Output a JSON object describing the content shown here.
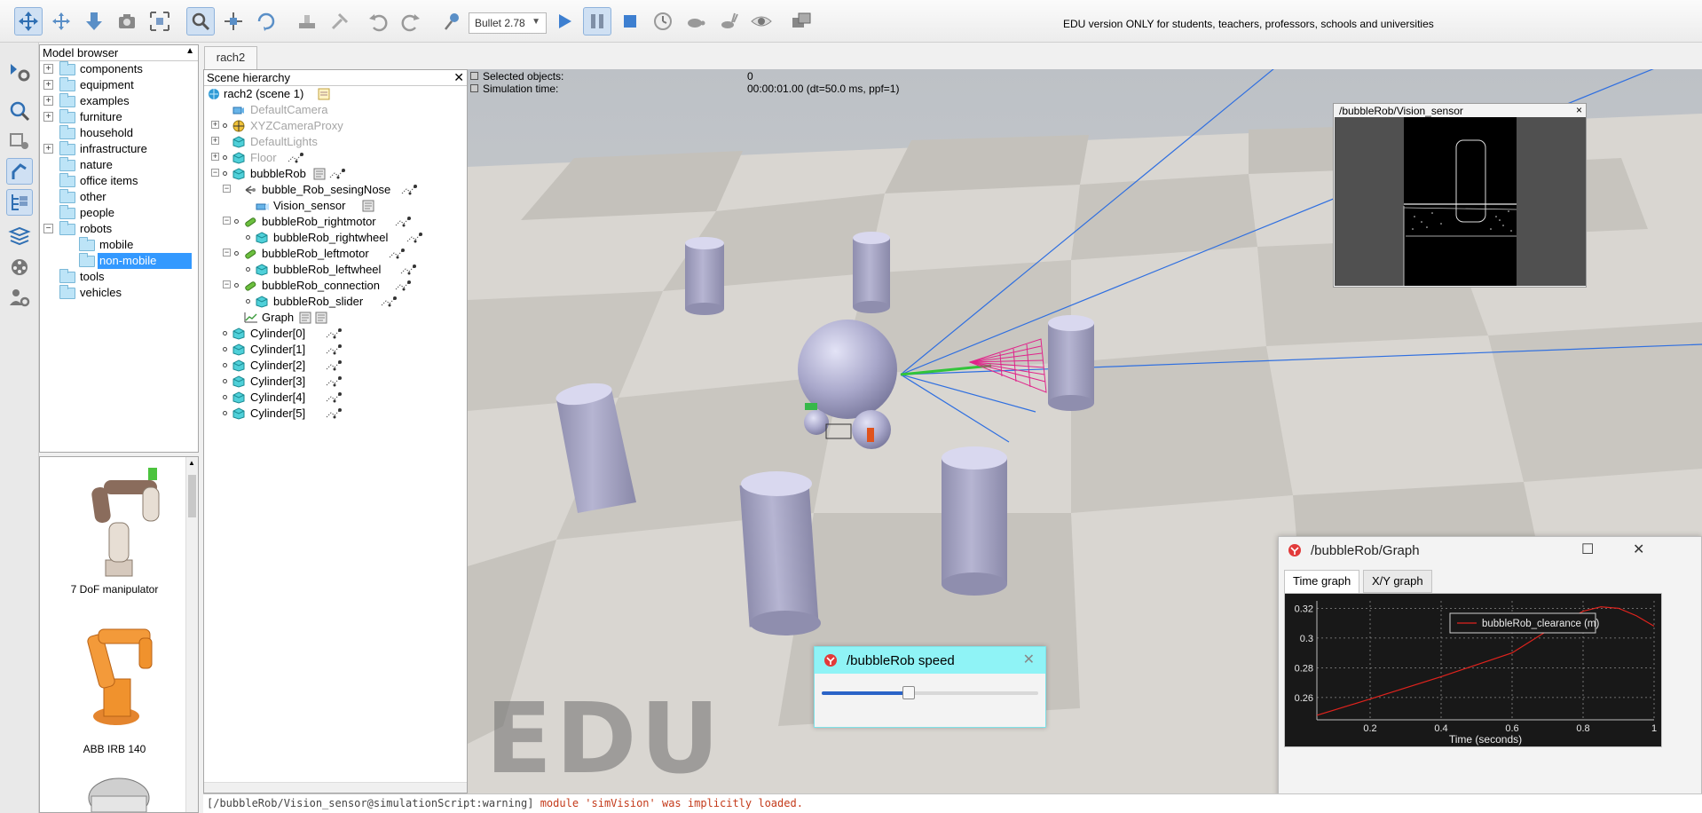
{
  "toolbar": {
    "engine": "Bullet 2.78",
    "edu_banner": "EDU version ONLY for students, teachers, professors, schools and universities",
    "buttons": [
      "camera-pan",
      "camera-rotate",
      "camera-shift",
      "camera-angle",
      "fit-to-view",
      "click-select",
      "object-shift",
      "object-rotate",
      "assemble",
      "transfer-dna",
      "undo",
      "redo",
      "dynamics-properties",
      "start-simulation",
      "pause-simulation",
      "stop-simulation",
      "real-time",
      "slow-down",
      "speed-up",
      "visualization-toggle",
      "page-selector"
    ]
  },
  "model_browser": {
    "title": "Model browser",
    "items": [
      {
        "label": "components",
        "expandable": true
      },
      {
        "label": "equipment",
        "expandable": true
      },
      {
        "label": "examples",
        "expandable": true
      },
      {
        "label": "furniture",
        "expandable": true
      },
      {
        "label": "household",
        "expandable": false
      },
      {
        "label": "infrastructure",
        "expandable": true
      },
      {
        "label": "nature",
        "expandable": false
      },
      {
        "label": "office items",
        "expandable": false
      },
      {
        "label": "other",
        "expandable": false
      },
      {
        "label": "people",
        "expandable": false
      },
      {
        "label": "robots",
        "expandable": true,
        "expanded": true
      },
      {
        "label": "mobile",
        "child": true
      },
      {
        "label": "non-mobile",
        "child": true,
        "selected": true
      },
      {
        "label": "tools",
        "expandable": false
      },
      {
        "label": "vehicles",
        "expandable": false
      }
    ]
  },
  "model_thumbnails": [
    {
      "label": "7 DoF manipulator"
    },
    {
      "label": "ABB IRB 140"
    }
  ],
  "scene_tab": {
    "label": "rach2"
  },
  "scene_hierarchy": {
    "title": "Scene hierarchy",
    "root": "rach2 (scene 1)",
    "items": [
      {
        "label": "DefaultCamera",
        "dim": true
      },
      {
        "label": "XYZCameraProxy",
        "dim": true
      },
      {
        "label": "DefaultLights",
        "dim": true
      },
      {
        "label": "Floor",
        "dim": true
      },
      {
        "label": "bubbleRob"
      },
      {
        "label": "bubble_Rob_sesingNose"
      },
      {
        "label": "Vision_sensor"
      },
      {
        "label": "bubbleRob_rightmotor"
      },
      {
        "label": "bubbleRob_rightwheel"
      },
      {
        "label": "bubbleRob_leftmotor"
      },
      {
        "label": "bubbleRob_leftwheel"
      },
      {
        "label": "bubbleRob_connection"
      },
      {
        "label": "bubbleRob_slider"
      },
      {
        "label": "Graph"
      },
      {
        "label": "Cylinder[0]"
      },
      {
        "label": "Cylinder[1]"
      },
      {
        "label": "Cylinder[2]"
      },
      {
        "label": "Cylinder[3]"
      },
      {
        "label": "Cylinder[4]"
      },
      {
        "label": "Cylinder[5]"
      }
    ]
  },
  "viewport": {
    "info": {
      "selected_label": "Selected objects:",
      "selected_value": "0",
      "simtime_label": "Simulation time:",
      "simtime_value": "00:00:01.00 (dt=50.0 ms, ppf=1)"
    },
    "watermark": "EDU"
  },
  "vision_window": {
    "title": "/bubbleRob/Vision_sensor",
    "close": "×"
  },
  "graph_window": {
    "title": "/bubbleRob/Graph",
    "tabs": [
      "Time graph",
      "X/Y graph"
    ],
    "active_tab": "Time graph"
  },
  "chart_data": {
    "type": "line",
    "xlabel": "Time (seconds)",
    "ylabel": "",
    "xlim": [
      0.05,
      1.0
    ],
    "ylim": [
      0.245,
      0.325
    ],
    "xticks": [
      "0.2",
      "0.4",
      "0.6",
      "0.8",
      "1"
    ],
    "yticks": [
      "0.26",
      "0.28",
      "0.3",
      "0.32"
    ],
    "grid": true,
    "legend_position": "top-right",
    "series": [
      {
        "name": "bubbleRob_clearance (m)",
        "color": "#e0231d",
        "x": [
          0.05,
          0.2,
          0.4,
          0.6,
          0.7,
          0.8,
          0.85,
          0.9,
          0.95,
          1.0
        ],
        "y": [
          0.248,
          0.259,
          0.274,
          0.29,
          0.305,
          0.318,
          0.321,
          0.32,
          0.315,
          0.308
        ]
      }
    ]
  },
  "speed_window": {
    "title": "/bubbleRob speed",
    "value": 0.4
  },
  "console": {
    "prefix": "[/bubbleRob/Vision_sensor@simulationScript:warning]",
    "message": "module 'simVision' was implicitly loaded."
  },
  "colors": {
    "accent": "#3399ff",
    "cylinder": "#aaa9c8",
    "cone": "#e0238a",
    "graph_bg": "#181818"
  }
}
